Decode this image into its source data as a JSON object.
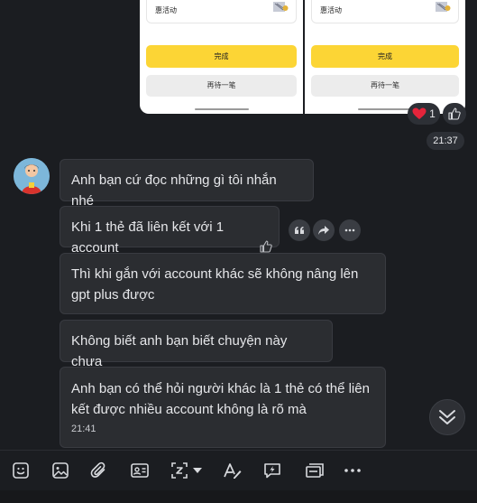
{
  "screenshots": [
    {
      "promo_label": "惠活动",
      "done_label": "完成",
      "again_label": "再待一笔"
    },
    {
      "promo_label": "惠活动",
      "done_label": "完成",
      "again_label": "再待一笔"
    }
  ],
  "reactions": {
    "emoji": "heart",
    "count": "1"
  },
  "time_divider": "21:37",
  "messages": [
    {
      "text": "Anh bạn cứ đọc những gì tôi nhắn nhé"
    },
    {
      "text": "Khi 1 thẻ đã liên kết với 1 account"
    },
    {
      "text": "Thì khi gắn với account khác sẽ không nâng lên gpt plus được"
    },
    {
      "text": "Không biết anh bạn biết chuyện này chưa"
    },
    {
      "text": "Anh bạn có thể hỏi người khác là 1 thẻ có thể liên kết được nhiều account không là rõ mà",
      "time": "21:41"
    }
  ],
  "colors": {
    "accent_yellow": "#fcd535",
    "bubble_bg": "#2b2d31",
    "page_bg": "#1b1d21",
    "heart": "#e5243b"
  },
  "toolbar_icons": [
    "emoji-icon",
    "image-icon",
    "attachment-icon",
    "contact-card-icon",
    "screenshot-icon",
    "dropdown-arrow-icon",
    "text-format-icon",
    "quick-reply-icon",
    "transfer-icon",
    "more-icon"
  ]
}
